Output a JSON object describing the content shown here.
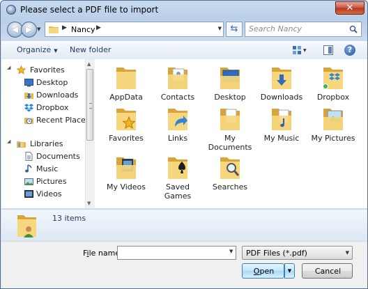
{
  "window": {
    "title": "Please select a PDF file to import",
    "close_glyph": "✕"
  },
  "address": {
    "crumb": "Nancy",
    "search_placeholder": "Search Nancy"
  },
  "toolbar": {
    "organize": "Organize",
    "new_folder": "New folder",
    "help_glyph": "?"
  },
  "nav": {
    "favorites_header": "Favorites",
    "favorites": [
      "Desktop",
      "Downloads",
      "Dropbox",
      "Recent Places"
    ],
    "libraries_header": "Libraries",
    "libraries": [
      "Documents",
      "Music",
      "Pictures",
      "Videos"
    ]
  },
  "files": [
    {
      "name": "AppData",
      "icon": "folder-icon"
    },
    {
      "name": "Contacts",
      "icon": "contacts-folder-icon"
    },
    {
      "name": "Desktop",
      "icon": "desktop-folder-icon"
    },
    {
      "name": "Downloads",
      "icon": "downloads-folder-icon"
    },
    {
      "name": "Dropbox",
      "icon": "dropbox-folder-icon"
    },
    {
      "name": "Favorites",
      "icon": "favorites-folder-icon"
    },
    {
      "name": "Links",
      "icon": "links-folder-icon"
    },
    {
      "name": "My Documents",
      "icon": "documents-folder-icon"
    },
    {
      "name": "My Music",
      "icon": "music-folder-icon"
    },
    {
      "name": "My Pictures",
      "icon": "pictures-folder-icon"
    },
    {
      "name": "My Videos",
      "icon": "videos-folder-icon"
    },
    {
      "name": "Saved Games",
      "icon": "saved-games-folder-icon"
    },
    {
      "name": "Searches",
      "icon": "searches-folder-icon"
    }
  ],
  "details": {
    "count_text": "13 items"
  },
  "bottom": {
    "file_name_label_first": "F",
    "file_name_label_u": "i",
    "file_name_label_rest": "le name:",
    "file_name_value": "",
    "filter_value": "PDF Files (*.pdf)",
    "open_label_u": "O",
    "open_label_rest": "pen",
    "cancel_label": "Cancel"
  },
  "colors": {
    "accent": "#3c7fb1",
    "folder": "#f1c75a",
    "title_bar": "#b9cfe8"
  }
}
